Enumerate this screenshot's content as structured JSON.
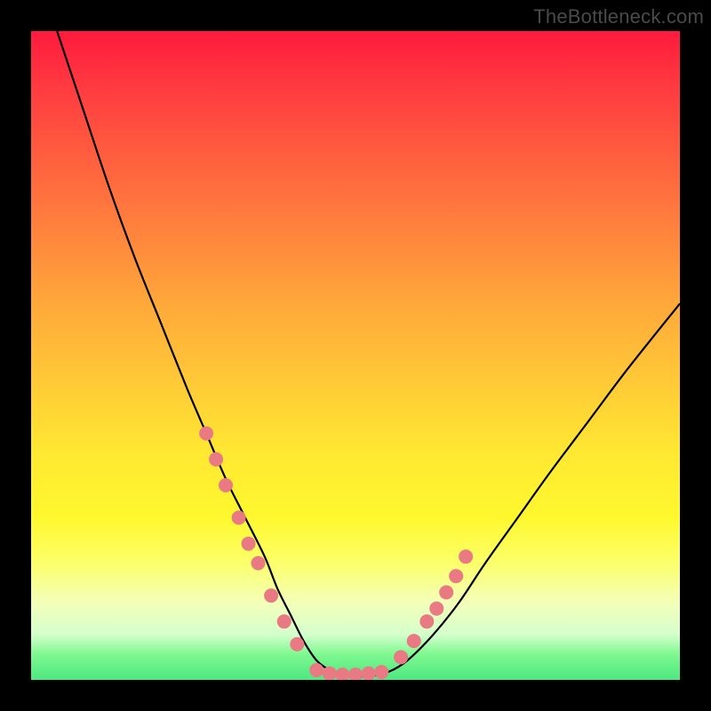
{
  "watermark": "TheBottleneck.com",
  "chart_data": {
    "type": "line",
    "title": "",
    "xlabel": "",
    "ylabel": "",
    "xlim": [
      0,
      100
    ],
    "ylim": [
      0,
      100
    ],
    "legend": false,
    "grid": false,
    "background_gradient": {
      "top": "#ff1a3d",
      "upper_mid": "#ffa83a",
      "mid": "#ffe832",
      "lower_mid": "#f4ffb8",
      "bottom": "#4de880"
    },
    "series": [
      {
        "name": "bottleneck-curve",
        "color": "#000000",
        "x": [
          4,
          8,
          12,
          16,
          20,
          24,
          27,
          30,
          33,
          36,
          38,
          40,
          42,
          44,
          46,
          48,
          52,
          55,
          58,
          62,
          66,
          70,
          75,
          80,
          86,
          92,
          100
        ],
        "y": [
          100,
          88,
          76,
          65,
          55,
          45,
          38,
          31,
          25,
          19,
          14,
          10,
          6,
          3,
          1.5,
          0.6,
          0.6,
          1.2,
          3,
          7,
          12,
          18,
          25,
          32,
          40,
          48,
          58
        ]
      }
    ],
    "markers": [
      {
        "name": "left-cluster",
        "color": "#e97a83",
        "points": [
          {
            "x": 27,
            "y": 38
          },
          {
            "x": 28.5,
            "y": 34
          },
          {
            "x": 30,
            "y": 30
          },
          {
            "x": 32,
            "y": 25
          },
          {
            "x": 33.5,
            "y": 21
          },
          {
            "x": 35,
            "y": 18
          },
          {
            "x": 37,
            "y": 13
          },
          {
            "x": 39,
            "y": 9
          },
          {
            "x": 41,
            "y": 5.5
          }
        ]
      },
      {
        "name": "bottom-cluster",
        "color": "#e97a83",
        "points": [
          {
            "x": 44,
            "y": 1.5
          },
          {
            "x": 46,
            "y": 1
          },
          {
            "x": 48,
            "y": 0.8
          },
          {
            "x": 50,
            "y": 0.8
          },
          {
            "x": 52,
            "y": 1
          },
          {
            "x": 54,
            "y": 1.2
          }
        ]
      },
      {
        "name": "right-cluster",
        "color": "#e97a83",
        "points": [
          {
            "x": 57,
            "y": 3.5
          },
          {
            "x": 59,
            "y": 6
          },
          {
            "x": 61,
            "y": 9
          },
          {
            "x": 62.5,
            "y": 11
          },
          {
            "x": 64,
            "y": 13.5
          },
          {
            "x": 65.5,
            "y": 16
          },
          {
            "x": 67,
            "y": 19
          }
        ]
      }
    ]
  }
}
